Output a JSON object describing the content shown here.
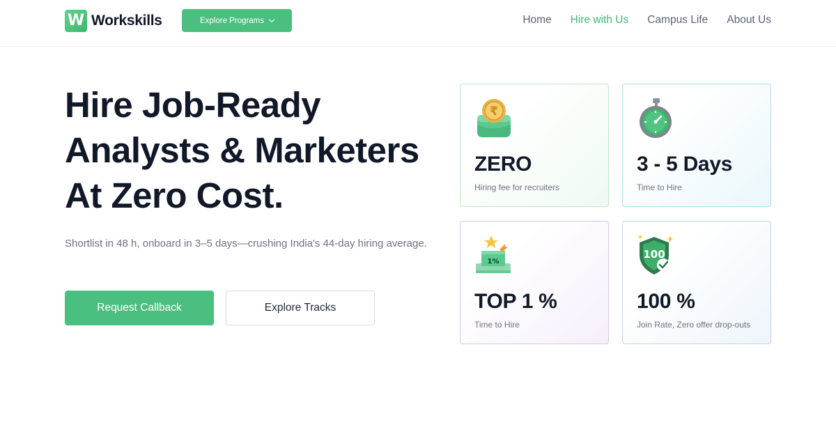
{
  "brand": {
    "logo_letter": "W",
    "name": "Workskills",
    "color": "#4bbf80"
  },
  "header": {
    "explore_programs": "Explore Programs",
    "nav": [
      {
        "label": "Home",
        "active": false
      },
      {
        "label": "Hire with Us",
        "active": true
      },
      {
        "label": "Campus Life",
        "active": false
      },
      {
        "label": "About Us",
        "active": false
      }
    ]
  },
  "hero": {
    "title_lines": [
      "Hire Job-Ready",
      "Analysts & Marketers",
      "At Zero Cost."
    ],
    "subtitle": "Shortlist in 48 h, onboard in 3–5 days—crushing India's 44-day hiring average.",
    "primary_button": "Request Callback",
    "secondary_button": "Explore Tracks"
  },
  "stats": [
    {
      "icon": "rupee-coin-icon",
      "value": "ZERO",
      "label": "Hiring fee for recruiters"
    },
    {
      "icon": "stopwatch-icon",
      "value": "3 - 5 Days",
      "label": "Time to Hire"
    },
    {
      "icon": "top-podium-icon",
      "value": "TOP 1 %",
      "label": "Time to Hire",
      "badge": "1%"
    },
    {
      "icon": "shield-check-icon",
      "value": "100 %",
      "label": "Join Rate, Zero offer drop-outs",
      "badge": "100"
    }
  ]
}
